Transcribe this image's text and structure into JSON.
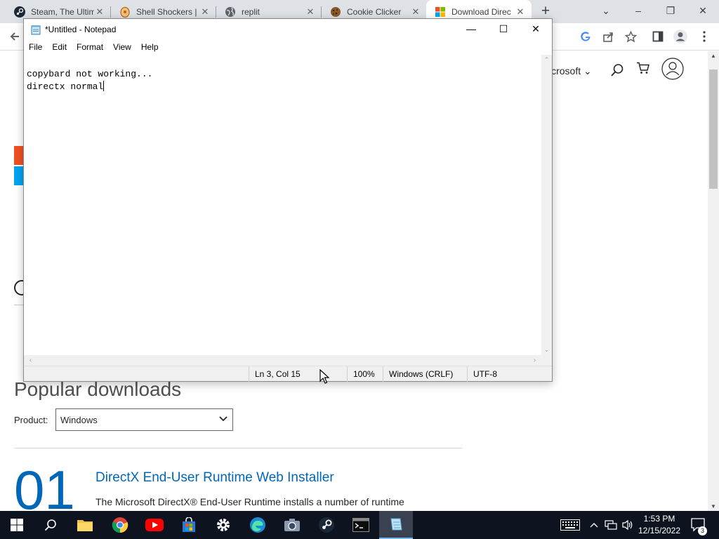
{
  "browser": {
    "tabs": [
      {
        "title": "Steam, The Ultim",
        "close": "✕",
        "icon": "steam-icon"
      },
      {
        "title": "Shell Shockers |",
        "close": "✕",
        "icon": "shell-shockers-icon"
      },
      {
        "title": "replit",
        "close": "✕",
        "icon": "globe-icon"
      },
      {
        "title": "Cookie Clicker",
        "close": "✕",
        "icon": "cookie-icon"
      },
      {
        "title": "Download Direc",
        "close": "✕",
        "icon": "microsoft-icon"
      }
    ],
    "new_tab": "+",
    "window_controls": {
      "tab_search": "⌄",
      "minimize": "–",
      "restore": "❐",
      "close": "✕"
    },
    "toolbar_icons": [
      "back-arrow-icon",
      "google-icon",
      "share-icon",
      "bookmark-star-icon",
      "side-panel-icon",
      "profile-icon",
      "more-menu-icon"
    ]
  },
  "webpage": {
    "nav": {
      "microsoft_text": "icrosoft",
      "chevron": "⌄"
    },
    "section_title": "Popular downloads",
    "product_label": "Product:",
    "product_value": "Windows",
    "download_number": "01",
    "download_title": "DirectX End-User Runtime Web Installer",
    "download_desc": "The Microsoft DirectX® End-User Runtime installs a number of runtime",
    "colors": {
      "accent": "#0067b8"
    }
  },
  "notepad": {
    "title": "*Untitled - Notepad",
    "controls": {
      "minimize": "—",
      "maximize": "☐",
      "close": "✕"
    },
    "menu": [
      "File",
      "Edit",
      "Format",
      "View",
      "Help"
    ],
    "lines": [
      "copybard not working...",
      "directx normal"
    ],
    "status": {
      "position": "Ln 3, Col 15",
      "zoom": "100%",
      "line_ending": "Windows (CRLF)",
      "encoding": "UTF-8"
    }
  },
  "taskbar": {
    "apps": [
      "start-icon",
      "search-icon",
      "file-explorer-icon",
      "chrome-icon",
      "youtube-icon",
      "microsoft-store-icon",
      "settings-icon",
      "edge-icon",
      "camera-icon",
      "steam-icon",
      "terminal-icon",
      "notepad-icon"
    ],
    "tray": {
      "time": "1:53 PM",
      "date": "12/15/2022",
      "notifications": "3"
    }
  }
}
